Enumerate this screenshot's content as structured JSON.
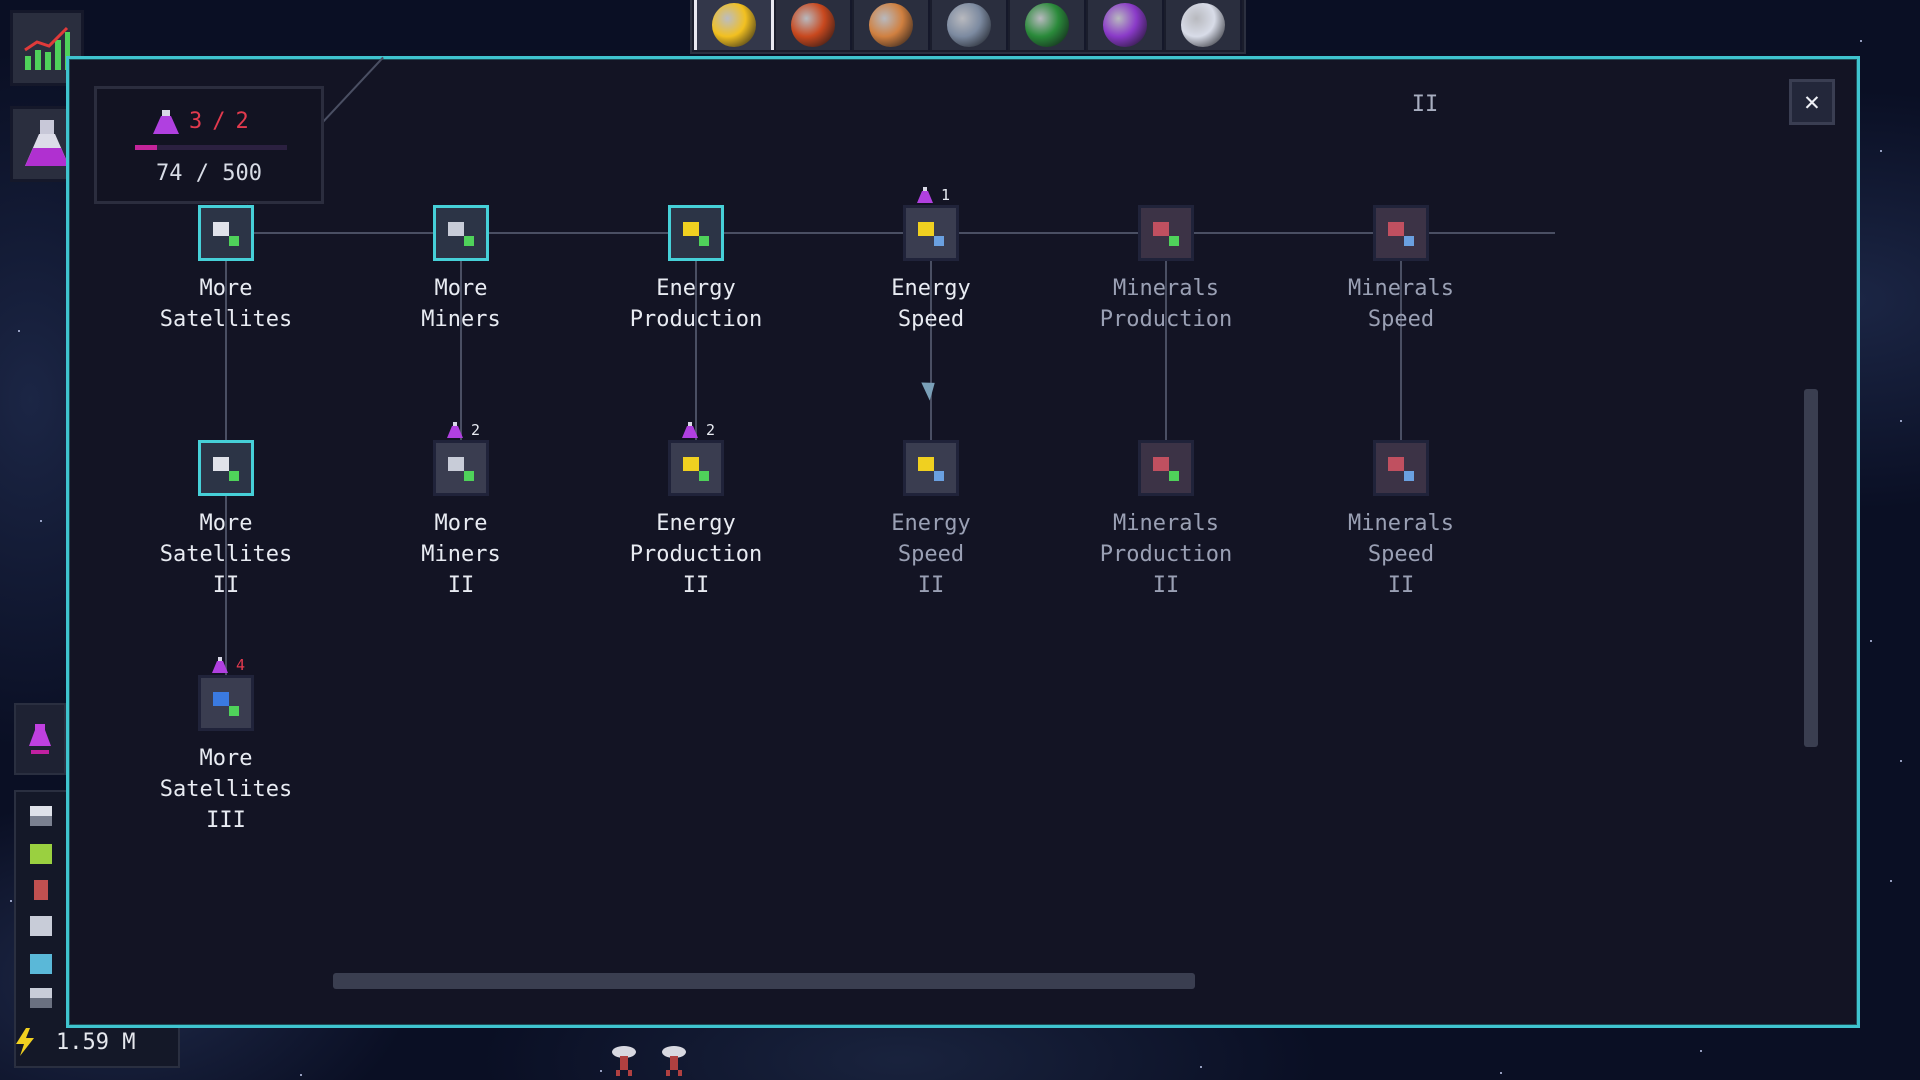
{
  "header": {
    "planet_tabs": [
      {
        "name": "sun-planet-icon",
        "color": "#f2c020",
        "selected": true
      },
      {
        "name": "lava-planet-icon",
        "color": "#c8481e",
        "selected": false
      },
      {
        "name": "desert-planet-icon",
        "color": "#d08040",
        "selected": false
      },
      {
        "name": "satellite-tool-icon",
        "color": "#7c8aa0",
        "selected": false
      },
      {
        "name": "earth-planet-icon",
        "color": "#2a8a3a",
        "selected": false
      },
      {
        "name": "violet-planet-icon",
        "color": "#8a3ac8",
        "selected": false
      },
      {
        "name": "moon-planet-icon",
        "color": "#d8dce8",
        "selected": false
      }
    ]
  },
  "research": {
    "points_used": "3",
    "separator": "/",
    "points_max": "2",
    "progress_text": "74 / 500",
    "progress_fraction": 0.148,
    "tier_label": "II"
  },
  "tree": {
    "row1": [
      {
        "label": "More\nSatellites",
        "state": "on",
        "type": "satellite"
      },
      {
        "label": "More\nMiners",
        "state": "on",
        "type": "miner"
      },
      {
        "label": "Energy\nProduction",
        "state": "on",
        "type": "energy"
      },
      {
        "label": "Energy\nSpeed",
        "state": "off",
        "type": "energy-speed",
        "cost": "1"
      },
      {
        "label": "Minerals\nProduction",
        "state": "dim",
        "type": "mineral"
      },
      {
        "label": "Minerals\nSpeed",
        "state": "dim",
        "type": "mineral-speed"
      }
    ],
    "row2": [
      {
        "label": "More\nSatellites\nII",
        "state": "on",
        "type": "satellite"
      },
      {
        "label": "More\nMiners\nII",
        "state": "off",
        "type": "miner",
        "cost": "2"
      },
      {
        "label": "Energy\nProduction\nII",
        "state": "off",
        "type": "energy",
        "cost": "2"
      },
      {
        "label": "Energy\nSpeed\nII",
        "state": "dim",
        "type": "energy-speed"
      },
      {
        "label": "Minerals\nProduction\nII",
        "state": "dim",
        "type": "mineral"
      },
      {
        "label": "Minerals\nSpeed\nII",
        "state": "dim",
        "type": "mineral-speed"
      }
    ],
    "row3": [
      {
        "label": "More\nSatellites\nIII",
        "state": "off",
        "type": "satellite-plus",
        "cost": "4",
        "cost_color": "#e23a4e"
      }
    ]
  },
  "resources": {
    "energy_value": "1.59 M"
  }
}
